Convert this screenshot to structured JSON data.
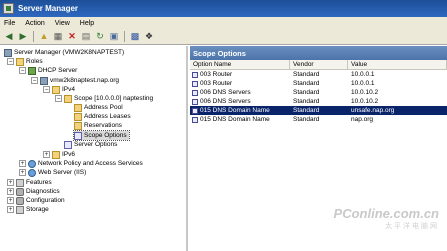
{
  "window": {
    "title": "Server Manager"
  },
  "menu": {
    "items": [
      "File",
      "Action",
      "View",
      "Help"
    ]
  },
  "toolbar": {
    "icons": [
      "back-arrow-icon",
      "forward-arrow-icon",
      "up-folder-icon",
      "show-hide-tree-icon",
      "delete-icon",
      "properties-icon",
      "refresh-icon",
      "export-list-icon",
      "help-icon",
      "extra-tool-icon"
    ]
  },
  "tree": {
    "items": [
      {
        "label": "Server Manager (VMW2K8NAPTEST)",
        "level": 0,
        "expander": "",
        "icon": "server"
      },
      {
        "label": "Roles",
        "level": 1,
        "expander": "−",
        "icon": "folder"
      },
      {
        "label": "DHCP Server",
        "level": 2,
        "expander": "−",
        "icon": "dhcp"
      },
      {
        "label": "vmw2k8naptest.nap.org",
        "level": 3,
        "expander": "−",
        "icon": "server"
      },
      {
        "label": "IPv4",
        "level": 4,
        "expander": "−",
        "icon": "folder"
      },
      {
        "label": "Scope [10.0.0.0] naptesting",
        "level": 5,
        "expander": "−",
        "icon": "folder"
      },
      {
        "label": "Address Pool",
        "level": 6,
        "expander": "",
        "icon": "folder"
      },
      {
        "label": "Address Leases",
        "level": 6,
        "expander": "",
        "icon": "folder"
      },
      {
        "label": "Reservations",
        "level": 6,
        "expander": "",
        "icon": "folder"
      },
      {
        "label": "Scope Options",
        "level": 6,
        "expander": "",
        "icon": "list",
        "selected": true
      },
      {
        "label": "Server Options",
        "level": 5,
        "expander": "",
        "icon": "list"
      },
      {
        "label": "IPv6",
        "level": 4,
        "expander": "+",
        "icon": "folder"
      },
      {
        "label": "Network Policy and Access Services",
        "level": 2,
        "expander": "+",
        "icon": "globe"
      },
      {
        "label": "Web Server (IIS)",
        "level": 2,
        "expander": "+",
        "icon": "globe"
      },
      {
        "label": "Features",
        "level": 1,
        "expander": "+",
        "icon": "feature"
      },
      {
        "label": "Diagnostics",
        "level": 1,
        "expander": "+",
        "icon": "gear"
      },
      {
        "label": "Configuration",
        "level": 1,
        "expander": "+",
        "icon": "gear"
      },
      {
        "label": "Storage",
        "level": 1,
        "expander": "+",
        "icon": "feature"
      }
    ]
  },
  "right_panel": {
    "title": "Scope Options",
    "columns": [
      "Option Name",
      "Vendor",
      "Value"
    ],
    "rows": [
      {
        "name": "003 Router",
        "vendor": "Standard",
        "value": "10.0.0.1",
        "selected": false
      },
      {
        "name": "003 Router",
        "vendor": "Standard",
        "value": "10.0.0.1",
        "selected": false
      },
      {
        "name": "006 DNS Servers",
        "vendor": "Standard",
        "value": "10.0.10.2",
        "selected": false
      },
      {
        "name": "006 DNS Servers",
        "vendor": "Standard",
        "value": "10.0.10.2",
        "selected": false
      },
      {
        "name": "015 DNS Domain Name",
        "vendor": "Standard",
        "value": "unsafe.nap.org",
        "selected": true
      },
      {
        "name": "015 DNS Domain Name",
        "vendor": "Standard",
        "value": "nap.org",
        "selected": false
      }
    ]
  },
  "watermark": {
    "main": "PConline.com.cn",
    "sub": "太平洋电脑网"
  }
}
